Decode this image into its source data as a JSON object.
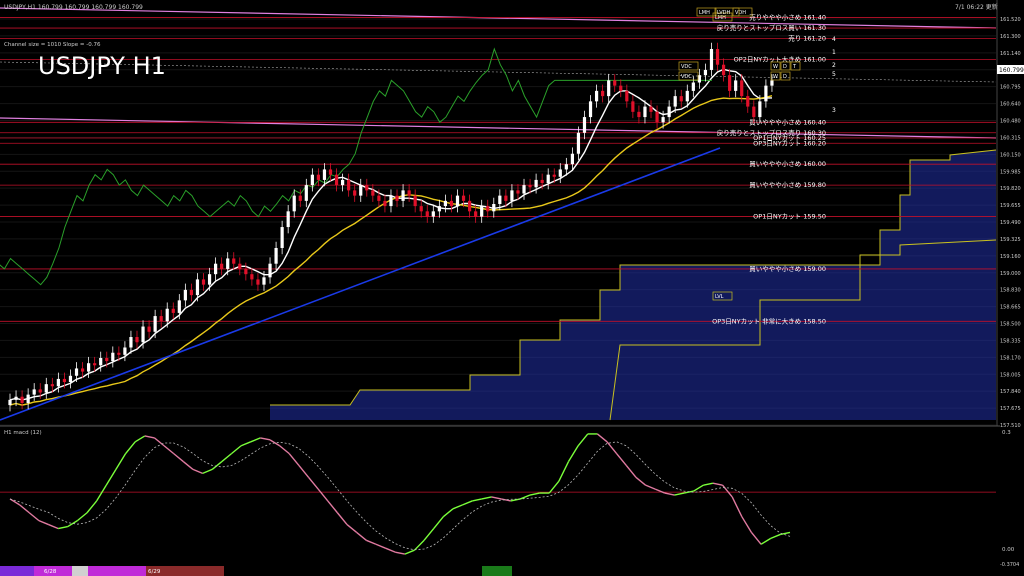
{
  "header": {
    "symbol_line": "USDJPY,H1  160.799 160.799 160.799 160.799",
    "channel_info": "Channel size = 1010 Slope = -0.76",
    "title": "USDJPY H1",
    "timestamp": "7/1 06:22 更新"
  },
  "macd": {
    "label": "H1  macd (12)",
    "top_value": "0.3",
    "zero_value": "0.00",
    "bottom_value": "-0.3704"
  },
  "bottom_bar": {
    "date_labels": [
      "6/28",
      "6/29"
    ],
    "segment_colors": [
      "#7a2ad8",
      "#c02ad8",
      "#d0d0d0",
      "#c02ad8",
      "#8a2a2a",
      "#8a2a2a",
      "#1a7a1a"
    ]
  },
  "colors": {
    "background": "#000000",
    "candle_up": "#ffffff",
    "candle_down": "#e0102a",
    "ma_white": "#ffffff",
    "ma_yellow": "#e8c81a",
    "ma_blue": "#1a3ae8",
    "channel_magenta": "#e080e0",
    "order_line": "#c0102a",
    "grid": "#1a1a1a",
    "green_line": "#2aa02a",
    "macd_up": "#7aff3a",
    "macd_down": "#e07aa0",
    "cloud_blue": "#2030a8",
    "cloud_yellow": "#c8c020"
  },
  "chart_data": {
    "type": "line",
    "title": "USDJPY H1",
    "ylim": [
      157.51,
      161.52
    ],
    "y_ticks": [
      "161.520",
      "161.300",
      "161.140",
      "160.970",
      "160.795",
      "160.640",
      "160.480",
      "160.315",
      "160.150",
      "159.985",
      "159.820",
      "159.655",
      "159.490",
      "159.325",
      "159.160",
      "159.000",
      "158.830",
      "158.665",
      "158.500",
      "158.335",
      "158.170",
      "158.005",
      "157.840",
      "157.675",
      "157.510"
    ],
    "current_price": "160.799",
    "price_levels": [
      {
        "label": "売りややや小さめ 161.40",
        "value": 161.4
      },
      {
        "label": "戻り売りとストップロス買い 161.30",
        "value": 161.3
      },
      {
        "label": "売り 161.20",
        "value": 161.2
      },
      {
        "label": "OP2日NYカット大きめ 161.00",
        "value": 161.0
      },
      {
        "label": "買いややや小さめ 160.40",
        "value": 160.4
      },
      {
        "label": "戻り売りとストップロス売り 160.30",
        "value": 160.3
      },
      {
        "label": "OP1日NYカット 160.25",
        "value": 160.25
      },
      {
        "label": "OP3日NYカット 160.20",
        "value": 160.2
      },
      {
        "label": "買いややや小さめ 160.00",
        "value": 160.0
      },
      {
        "label": "買いややや小さめ 159.80",
        "value": 159.8
      },
      {
        "label": "OP1日NYカット 159.50",
        "value": 159.5
      },
      {
        "label": "買いややや小さめ 159.00",
        "value": 159.0
      },
      {
        "label": "OP3日NYカット 非常に大きめ 158.50",
        "value": 158.5
      }
    ],
    "wave_labels": [
      "1",
      "2",
      "3",
      "4",
      "5"
    ],
    "badge_labels": [
      "VDC",
      "VDC",
      "LVL",
      "VDH",
      "LMH",
      "LMH",
      "LVDH",
      "W",
      "D",
      "T",
      "W",
      "D"
    ],
    "close_prices": [
      157.75,
      157.78,
      157.72,
      157.8,
      157.85,
      157.82,
      157.9,
      157.88,
      157.95,
      157.92,
      157.98,
      158.05,
      158.02,
      158.1,
      158.08,
      158.15,
      158.12,
      158.2,
      158.18,
      158.25,
      158.35,
      158.3,
      158.45,
      158.4,
      158.55,
      158.5,
      158.62,
      158.58,
      158.7,
      158.8,
      158.75,
      158.9,
      158.85,
      158.95,
      159.05,
      159.0,
      159.1,
      159.05,
      159.0,
      158.95,
      158.9,
      158.85,
      158.92,
      159.05,
      159.2,
      159.4,
      159.55,
      159.7,
      159.65,
      159.8,
      159.9,
      159.85,
      159.95,
      159.9,
      159.8,
      159.85,
      159.75,
      159.7,
      159.8,
      159.75,
      159.7,
      159.65,
      159.6,
      159.7,
      159.65,
      159.75,
      159.7,
      159.6,
      159.55,
      159.5,
      159.55,
      159.6,
      159.65,
      159.6,
      159.7,
      159.65,
      159.55,
      159.5,
      159.6,
      159.55,
      159.62,
      159.7,
      159.65,
      159.75,
      159.72,
      159.8,
      159.78,
      159.85,
      159.82,
      159.9,
      159.88,
      159.95,
      160.0,
      160.1,
      160.3,
      160.45,
      160.6,
      160.7,
      160.65,
      160.8,
      160.75,
      160.7,
      160.6,
      160.5,
      160.45,
      160.55,
      160.5,
      160.4,
      160.45,
      160.55,
      160.65,
      160.6,
      160.7,
      160.78,
      160.85,
      160.9,
      161.1,
      160.95,
      160.85,
      160.7,
      160.8,
      160.65,
      160.55,
      160.45,
      160.6,
      160.75,
      160.8
    ],
    "macd_values": [
      -0.05,
      -0.08,
      -0.12,
      -0.16,
      -0.18,
      -0.2,
      -0.19,
      -0.16,
      -0.12,
      -0.06,
      0.02,
      0.1,
      0.18,
      0.24,
      0.27,
      0.26,
      0.22,
      0.18,
      0.14,
      0.1,
      0.08,
      0.1,
      0.14,
      0.18,
      0.22,
      0.24,
      0.26,
      0.25,
      0.22,
      0.18,
      0.12,
      0.06,
      0.0,
      -0.06,
      -0.12,
      -0.18,
      -0.22,
      -0.26,
      -0.28,
      -0.3,
      -0.32,
      -0.33,
      -0.31,
      -0.26,
      -0.2,
      -0.14,
      -0.1,
      -0.08,
      -0.06,
      -0.05,
      -0.04,
      -0.05,
      -0.06,
      -0.05,
      -0.03,
      -0.02,
      -0.02,
      0.04,
      0.14,
      0.22,
      0.28,
      0.28,
      0.24,
      0.18,
      0.12,
      0.06,
      0.02,
      0.0,
      -0.02,
      -0.03,
      -0.02,
      -0.01,
      0.02,
      0.03,
      0.02,
      -0.04,
      -0.14,
      -0.22,
      -0.28,
      -0.25,
      -0.23,
      -0.22
    ]
  }
}
